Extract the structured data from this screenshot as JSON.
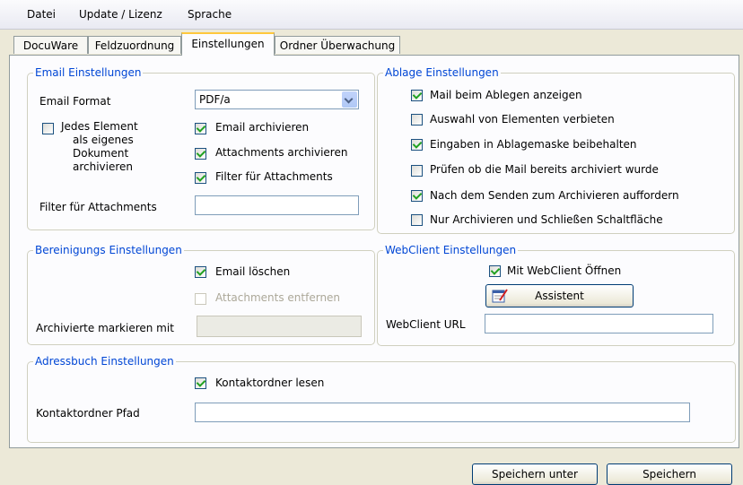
{
  "menu": [
    "Datei",
    "Update / Lizenz",
    "Sprache"
  ],
  "tabs": [
    "DocuWare",
    "Feldzuordnung",
    "Einstellungen",
    "Ordner Überwachung"
  ],
  "email": {
    "title": "Email Einstellungen",
    "format_label": "Email Format",
    "format_value": "PDF/a",
    "jedes": {
      "line1": "Jedes Element",
      "line2": "als eigenes",
      "line3": "Dokument",
      "line4": "archivieren",
      "checked": false
    },
    "archivieren": {
      "label": "Email archivieren",
      "checked": true
    },
    "attachments": {
      "label": "Attachments archivieren",
      "checked": true
    },
    "filter": {
      "label": "Filter für Attachments",
      "checked": true
    },
    "filter_field_label": "Filter für Attachments",
    "filter_field_value": ""
  },
  "ablage": {
    "title": "Ablage Einstellungen",
    "items": [
      {
        "label": "Mail beim Ablegen anzeigen",
        "checked": true
      },
      {
        "label": "Auswahl von Elementen verbieten",
        "checked": false
      },
      {
        "label": "Eingaben in Ablagemaske beibehalten",
        "checked": true
      },
      {
        "label": "Prüfen ob die Mail bereits archiviert wurde",
        "checked": false
      },
      {
        "label": "Nach dem Senden zum Archivieren auffordern",
        "checked": true
      },
      {
        "label": "Nur Archivieren und Schließen Schaltfläche",
        "checked": false
      }
    ]
  },
  "bereinigung": {
    "title": "Bereinigungs Einstellungen",
    "loeschen": {
      "label": "Email löschen",
      "checked": true
    },
    "entfernen": {
      "label": "Attachments entfernen",
      "checked": false
    },
    "markieren_label": "Archivierte markieren mit",
    "markieren_value": ""
  },
  "webclient": {
    "title": "WebClient Einstellungen",
    "oeffnen": {
      "label": "Mit WebClient Öffnen",
      "checked": true
    },
    "assistent_label": "Assistent",
    "url_label": "WebClient URL",
    "url_value": ""
  },
  "adressbuch": {
    "title": "Adressbuch Einstellungen",
    "kontakt": {
      "label": "Kontaktordner lesen",
      "checked": true
    },
    "pfad_label": "Kontaktordner Pfad",
    "pfad_value": ""
  },
  "footer": {
    "save_as": "Speichern unter",
    "save": "Speichern"
  },
  "colors": {
    "group_title": "#0046d5",
    "checkmark": "#21a121",
    "tab_highlight": "#ffc83c"
  }
}
